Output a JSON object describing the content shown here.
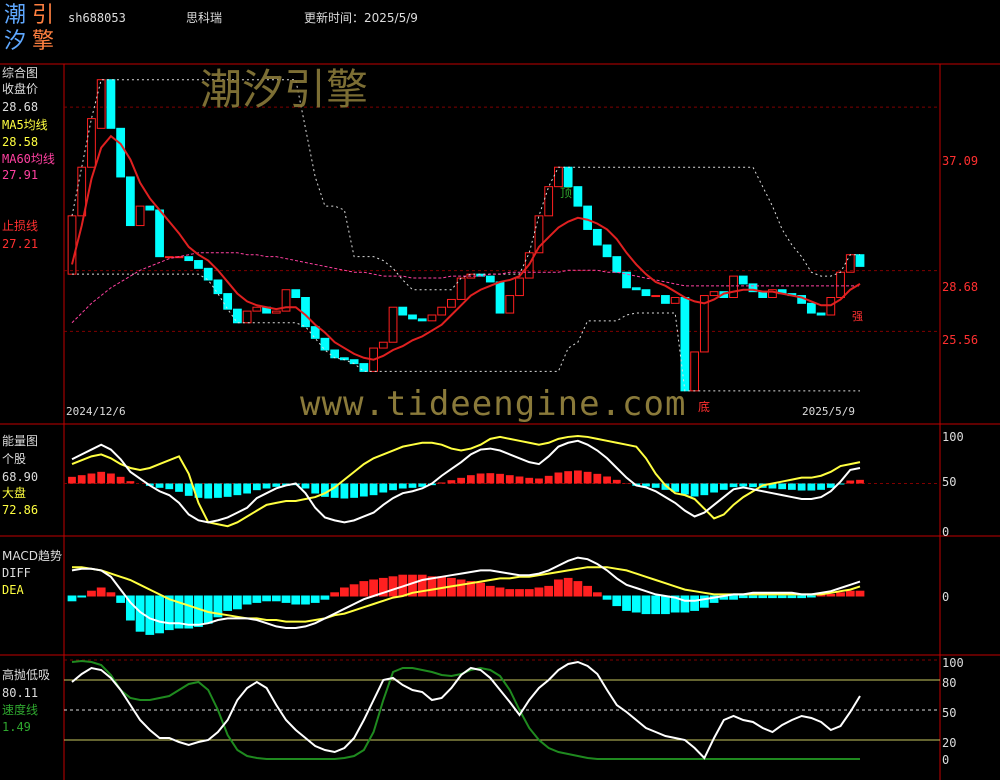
{
  "header": {
    "logo_chars": [
      "潮",
      "引",
      "汐",
      "擎"
    ],
    "code": "sh688053",
    "name": "思科瑞",
    "update_label": "更新时间：2025/5/9"
  },
  "watermarks": {
    "cn": "潮汐引擎",
    "url": "www.tideengine.com"
  },
  "colors": {
    "up": "#ff2020",
    "down": "#00ffff",
    "ma5": "#ffff40",
    "ma60": "#ff40a0",
    "border": "#c00000",
    "grid": "#800000"
  },
  "panel1": {
    "title": "综合图",
    "close_label": "收盘价",
    "close_value": "28.68",
    "ma5_label": "MA5均线",
    "ma5_value": "28.58",
    "ma60_label": "MA60均线",
    "ma60_value": "27.91",
    "stop_label": "止损线",
    "stop_value": "27.21",
    "right_ticks": [
      "37.09",
      "28.68",
      "25.56"
    ],
    "date_start": "2024/12/6",
    "date_end": "2025/5/9",
    "top_marker": "顶",
    "bottom_marker": "底",
    "small_marker": "强"
  },
  "panel2": {
    "title": "能量图",
    "stock_label": "个股",
    "stock_value": "68.90",
    "market_label": "大盘",
    "market_value": "72.86",
    "right_ticks": [
      "100",
      "50",
      "0"
    ]
  },
  "panel3": {
    "title": "MACD趋势",
    "diff_label": "DIFF",
    "dea_label": "DEA",
    "right_ticks": [
      "0"
    ]
  },
  "panel4": {
    "title": "高抛低吸",
    "value": "80.11",
    "speed_label": "速度线",
    "speed_value": "1.49",
    "right_ticks": [
      "100",
      "80",
      "50",
      "20",
      "0"
    ]
  },
  "chart_data": {
    "type": "line",
    "x_range": [
      "2024/12/6",
      "2025/5/9"
    ],
    "candles": [
      {
        "o": 28.5,
        "c": 31.5
      },
      {
        "o": 31.5,
        "c": 34.0
      },
      {
        "o": 34.0,
        "c": 36.5
      },
      {
        "o": 36.0,
        "c": 38.5
      },
      {
        "o": 38.5,
        "c": 36.0
      },
      {
        "o": 36.0,
        "c": 33.5
      },
      {
        "o": 33.5,
        "c": 31.0
      },
      {
        "o": 31.0,
        "c": 32.0
      },
      {
        "o": 32.0,
        "c": 31.8
      },
      {
        "o": 31.8,
        "c": 29.4
      },
      {
        "o": 29.4,
        "c": 29.4
      },
      {
        "o": 29.4,
        "c": 29.4
      },
      {
        "o": 29.4,
        "c": 29.2
      },
      {
        "o": 29.2,
        "c": 28.8
      },
      {
        "o": 28.8,
        "c": 28.2
      },
      {
        "o": 28.2,
        "c": 27.5
      },
      {
        "o": 27.5,
        "c": 26.7
      },
      {
        "o": 26.7,
        "c": 26.0
      },
      {
        "o": 26.0,
        "c": 26.6
      },
      {
        "o": 26.6,
        "c": 26.8
      },
      {
        "o": 26.8,
        "c": 26.5
      },
      {
        "o": 26.5,
        "c": 26.6
      },
      {
        "o": 26.6,
        "c": 27.7
      },
      {
        "o": 27.7,
        "c": 27.3
      },
      {
        "o": 27.3,
        "c": 25.8
      },
      {
        "o": 25.8,
        "c": 25.2
      },
      {
        "o": 25.2,
        "c": 24.6
      },
      {
        "o": 24.6,
        "c": 24.2
      },
      {
        "o": 24.2,
        "c": 24.1
      },
      {
        "o": 24.1,
        "c": 23.9
      },
      {
        "o": 23.9,
        "c": 23.5
      },
      {
        "o": 23.5,
        "c": 24.7
      },
      {
        "o": 24.7,
        "c": 25.0
      },
      {
        "o": 25.0,
        "c": 26.8
      },
      {
        "o": 26.8,
        "c": 26.4
      },
      {
        "o": 26.4,
        "c": 26.2
      },
      {
        "o": 26.2,
        "c": 26.1
      },
      {
        "o": 26.1,
        "c": 26.4
      },
      {
        "o": 26.4,
        "c": 26.8
      },
      {
        "o": 26.8,
        "c": 27.2
      },
      {
        "o": 27.2,
        "c": 28.3
      },
      {
        "o": 28.3,
        "c": 28.5
      },
      {
        "o": 28.5,
        "c": 28.4
      },
      {
        "o": 28.4,
        "c": 28.1
      },
      {
        "o": 28.1,
        "c": 26.5
      },
      {
        "o": 26.5,
        "c": 27.4
      },
      {
        "o": 27.4,
        "c": 28.3
      },
      {
        "o": 28.3,
        "c": 29.6
      },
      {
        "o": 29.6,
        "c": 31.5
      },
      {
        "o": 31.5,
        "c": 33.0
      },
      {
        "o": 33.0,
        "c": 34.0
      },
      {
        "o": 34.0,
        "c": 33.0
      },
      {
        "o": 33.0,
        "c": 32.0
      },
      {
        "o": 32.0,
        "c": 30.8
      },
      {
        "o": 30.8,
        "c": 30.0
      },
      {
        "o": 30.0,
        "c": 29.4
      },
      {
        "o": 29.4,
        "c": 28.6
      },
      {
        "o": 28.6,
        "c": 27.8
      },
      {
        "o": 27.8,
        "c": 27.7
      },
      {
        "o": 27.7,
        "c": 27.4
      },
      {
        "o": 27.4,
        "c": 27.4
      },
      {
        "o": 27.4,
        "c": 27.0
      },
      {
        "o": 27.0,
        "c": 27.3
      },
      {
        "o": 27.3,
        "c": 22.5
      },
      {
        "o": 22.5,
        "c": 24.5
      },
      {
        "o": 24.5,
        "c": 27.4
      },
      {
        "o": 27.4,
        "c": 27.6
      },
      {
        "o": 27.6,
        "c": 27.3
      },
      {
        "o": 27.3,
        "c": 28.4
      },
      {
        "o": 28.4,
        "c": 28.0
      },
      {
        "o": 28.0,
        "c": 27.6
      },
      {
        "o": 27.6,
        "c": 27.3
      },
      {
        "o": 27.3,
        "c": 27.7
      },
      {
        "o": 27.7,
        "c": 27.5
      },
      {
        "o": 27.5,
        "c": 27.4
      },
      {
        "o": 27.4,
        "c": 27.0
      },
      {
        "o": 27.0,
        "c": 26.5
      },
      {
        "o": 26.5,
        "c": 26.4
      },
      {
        "o": 26.4,
        "c": 27.3
      },
      {
        "o": 27.3,
        "c": 28.6
      },
      {
        "o": 28.6,
        "c": 29.5
      },
      {
        "o": 29.5,
        "c": 28.9
      }
    ],
    "ma5": [
      29.0,
      31.0,
      33.4,
      35.0,
      35.6,
      35.2,
      34.4,
      33.2,
      32.4,
      31.8,
      31.2,
      30.6,
      29.9,
      29.5,
      29.2,
      28.7,
      28.1,
      27.5,
      27.1,
      26.9,
      26.8,
      26.7,
      26.8,
      26.8,
      26.4,
      25.9,
      25.5,
      25.0,
      24.7,
      24.4,
      24.2,
      24.1,
      24.3,
      24.6,
      24.8,
      25.1,
      25.3,
      25.6,
      25.9,
      26.4,
      26.9,
      27.4,
      27.7,
      27.9,
      28.1,
      28.2,
      28.4,
      29.0,
      29.9,
      30.4,
      30.9,
      31.2,
      31.4,
      31.3,
      31.1,
      30.8,
      30.3,
      29.6,
      29.0,
      28.5,
      28.1,
      27.9,
      27.6,
      27.3,
      27.1,
      27.0,
      27.2,
      27.5,
      27.6,
      27.7,
      27.7,
      27.6,
      27.6,
      27.5,
      27.4,
      27.3,
      27.1,
      26.9,
      26.9,
      27.2,
      27.7,
      28.0
    ],
    "ma60": [
      26.0,
      26.5,
      27.0,
      27.4,
      27.8,
      28.1,
      28.4,
      28.7,
      28.9,
      29.1,
      29.3,
      29.4,
      29.5,
      29.6,
      29.6,
      29.6,
      29.6,
      29.6,
      29.5,
      29.5,
      29.4,
      29.4,
      29.3,
      29.2,
      29.1,
      29.0,
      28.9,
      28.8,
      28.7,
      28.6,
      28.6,
      28.5,
      28.4,
      28.4,
      28.4,
      28.3,
      28.3,
      28.3,
      28.3,
      28.4,
      28.4,
      28.4,
      28.4,
      28.5,
      28.5,
      28.6,
      28.6,
      28.6,
      28.6,
      28.6,
      28.6,
      28.7,
      28.7,
      28.7,
      28.7,
      28.6,
      28.6,
      28.5,
      28.4,
      28.3,
      28.2,
      28.1,
      28.0,
      27.9,
      27.9,
      27.9,
      27.9,
      27.9,
      27.9,
      27.9,
      27.9,
      27.9,
      27.9,
      27.9,
      27.9,
      27.9,
      27.9,
      27.9,
      27.9,
      27.9,
      27.9,
      27.9
    ],
    "energy_stock": [
      75,
      80,
      85,
      90,
      85,
      75,
      62,
      55,
      48,
      42,
      38,
      30,
      18,
      12,
      10,
      12,
      15,
      20,
      25,
      35,
      40,
      45,
      48,
      50,
      40,
      25,
      15,
      12,
      10,
      12,
      16,
      20,
      28,
      35,
      40,
      42,
      45,
      50,
      58,
      65,
      72,
      80,
      85,
      86,
      84,
      80,
      76,
      72,
      70,
      78,
      88,
      92,
      94,
      90,
      84,
      76,
      66,
      56,
      48,
      46,
      42,
      36,
      30,
      22,
      16,
      20,
      28,
      36,
      44,
      46,
      44,
      42,
      40,
      38,
      36,
      34,
      34,
      36,
      42,
      52,
      64,
      66
    ],
    "energy_market": [
      70,
      74,
      78,
      80,
      76,
      70,
      66,
      64,
      66,
      70,
      74,
      78,
      60,
      30,
      10,
      8,
      6,
      10,
      16,
      22,
      28,
      30,
      32,
      32,
      34,
      36,
      40,
      46,
      54,
      62,
      70,
      76,
      80,
      84,
      88,
      90,
      92,
      92,
      90,
      86,
      84,
      86,
      90,
      96,
      98,
      96,
      94,
      92,
      90,
      92,
      96,
      98,
      99,
      98,
      96,
      94,
      92,
      90,
      88,
      76,
      60,
      48,
      40,
      38,
      34,
      24,
      14,
      18,
      28,
      36,
      42,
      48,
      50,
      52,
      54,
      56,
      56,
      58,
      62,
      68,
      70,
      72
    ],
    "macd_hist": [
      -0.3,
      0.0,
      0.3,
      0.5,
      0.2,
      -0.4,
      -1.5,
      -2.2,
      -2.4,
      -2.3,
      -2.1,
      -2.0,
      -2.0,
      -1.9,
      -1.7,
      -1.3,
      -0.9,
      -0.8,
      -0.5,
      -0.4,
      -0.3,
      -0.3,
      -0.4,
      -0.5,
      -0.5,
      -0.4,
      -0.2,
      0.2,
      0.5,
      0.7,
      0.9,
      1.0,
      1.1,
      1.2,
      1.3,
      1.3,
      1.3,
      1.2,
      1.2,
      1.1,
      1.0,
      0.9,
      0.8,
      0.6,
      0.5,
      0.4,
      0.4,
      0.4,
      0.5,
      0.6,
      1.0,
      1.1,
      0.9,
      0.6,
      0.2,
      -0.2,
      -0.6,
      -0.9,
      -1.0,
      -1.1,
      -1.1,
      -1.1,
      -1.0,
      -1.0,
      -0.9,
      -0.7,
      -0.4,
      -0.2,
      -0.2,
      -0.1,
      -0.1,
      -0.1,
      -0.1,
      -0.1,
      -0.1,
      -0.1,
      0.0,
      0.1,
      0.1,
      0.2,
      0.3,
      0.3
    ],
    "diff": [
      1.6,
      1.7,
      1.7,
      1.6,
      1.2,
      0.4,
      -0.4,
      -1.0,
      -1.4,
      -1.6,
      -1.7,
      -1.7,
      -1.8,
      -1.8,
      -1.7,
      -1.5,
      -1.4,
      -1.4,
      -1.4,
      -1.5,
      -1.7,
      -1.9,
      -2.0,
      -2.0,
      -1.9,
      -1.7,
      -1.4,
      -1.1,
      -0.8,
      -0.5,
      -0.2,
      0.0,
      0.2,
      0.4,
      0.6,
      0.8,
      1.0,
      1.1,
      1.2,
      1.3,
      1.4,
      1.5,
      1.6,
      1.6,
      1.5,
      1.4,
      1.3,
      1.3,
      1.4,
      1.6,
      1.9,
      2.2,
      2.4,
      2.3,
      2.0,
      1.6,
      1.1,
      0.7,
      0.5,
      0.3,
      0.1,
      0.0,
      -0.1,
      -0.3,
      -0.3,
      -0.2,
      -0.1,
      0.0,
      0.1,
      0.1,
      0.2,
      0.2,
      0.2,
      0.2,
      0.2,
      0.1,
      0.1,
      0.2,
      0.3,
      0.5,
      0.7,
      0.9
    ],
    "dea": [
      1.8,
      1.8,
      1.7,
      1.6,
      1.4,
      1.2,
      1.0,
      0.7,
      0.4,
      0.1,
      -0.2,
      -0.4,
      -0.6,
      -0.8,
      -1.0,
      -1.1,
      -1.2,
      -1.3,
      -1.4,
      -1.4,
      -1.5,
      -1.5,
      -1.6,
      -1.6,
      -1.6,
      -1.5,
      -1.4,
      -1.2,
      -1.1,
      -0.9,
      -0.7,
      -0.5,
      -0.3,
      -0.1,
      0.0,
      0.2,
      0.3,
      0.4,
      0.5,
      0.6,
      0.7,
      0.8,
      0.9,
      1.0,
      1.1,
      1.1,
      1.2,
      1.2,
      1.3,
      1.4,
      1.5,
      1.6,
      1.7,
      1.8,
      1.8,
      1.8,
      1.7,
      1.6,
      1.4,
      1.2,
      1.0,
      0.8,
      0.6,
      0.4,
      0.3,
      0.2,
      0.1,
      0.1,
      0.1,
      0.1,
      0.1,
      0.1,
      0.1,
      0.1,
      0.1,
      0.1,
      0.1,
      0.1,
      0.2,
      0.3,
      0.4,
      0.6
    ],
    "gaopao": [
      78,
      86,
      92,
      90,
      82,
      70,
      55,
      40,
      30,
      22,
      22,
      18,
      15,
      18,
      20,
      28,
      40,
      60,
      72,
      78,
      72,
      55,
      40,
      30,
      22,
      14,
      10,
      8,
      12,
      22,
      40,
      60,
      80,
      82,
      75,
      70,
      68,
      60,
      62,
      72,
      85,
      92,
      90,
      82,
      70,
      58,
      45,
      60,
      72,
      80,
      90,
      96,
      98,
      94,
      86,
      70,
      55,
      48,
      40,
      32,
      28,
      24,
      22,
      20,
      12,
      2,
      22,
      40,
      44,
      40,
      38,
      32,
      28,
      35,
      40,
      44,
      42,
      38,
      30,
      34,
      48,
      64,
      78,
      88,
      82
    ],
    "speed": [
      98,
      99,
      98,
      95,
      85,
      70,
      62,
      60,
      60,
      62,
      64,
      70,
      76,
      78,
      70,
      50,
      25,
      10,
      4,
      2,
      1,
      1,
      1,
      1,
      1,
      1,
      1,
      1,
      2,
      4,
      10,
      28,
      60,
      88,
      92,
      92,
      90,
      88,
      85,
      84,
      86,
      90,
      92,
      90,
      84,
      70,
      50,
      32,
      20,
      12,
      8,
      6,
      4,
      2,
      1,
      1,
      1,
      1,
      1,
      1,
      1,
      1,
      1,
      1,
      1,
      1,
      1,
      1,
      1,
      1,
      1,
      1,
      1,
      1,
      1,
      1,
      1,
      1,
      1,
      1,
      1,
      1,
      1
    ],
    "y_range_price": [
      21,
      39
    ]
  }
}
